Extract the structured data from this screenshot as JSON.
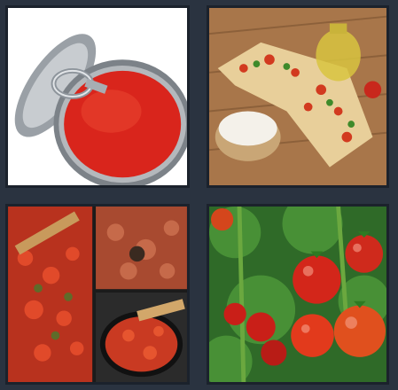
{
  "puzzle": {
    "images": [
      {
        "subject": "open-tin-of-tomato-puree",
        "icon": "tomato-can-icon"
      },
      {
        "subject": "bruschetta-with-olive-oil-and-flour",
        "icon": "bruschetta-icon"
      },
      {
        "subject": "tomato-sauce-cooking-collage",
        "icon": "pan-icon"
      },
      {
        "subject": "tomatoes-on-the-vine",
        "icon": "tomato-vine-icon"
      }
    ],
    "colors": {
      "background": "#2a3340",
      "frame": "#1b222c",
      "tomato": "#d9251c",
      "wood": "#a8764a"
    }
  }
}
